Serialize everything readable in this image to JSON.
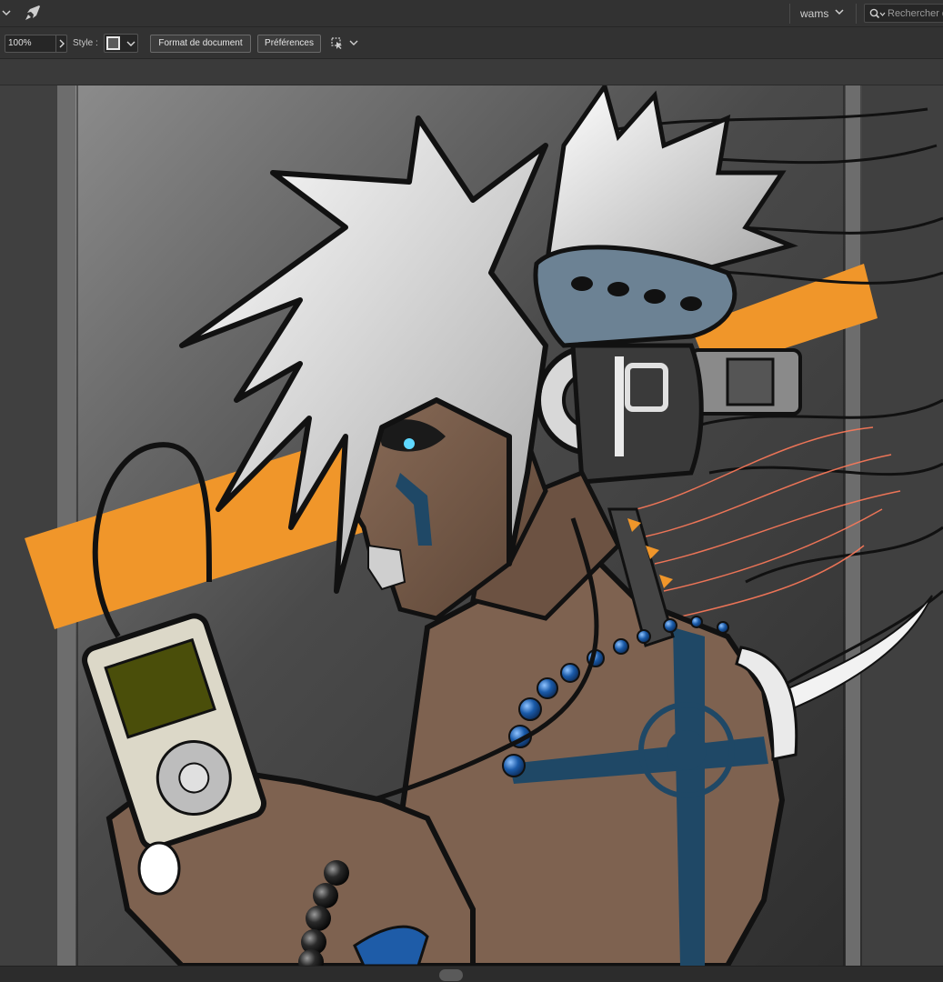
{
  "topbar": {
    "workspace_label": "wams",
    "search_placeholder": "Rechercher d"
  },
  "control_bar": {
    "zoom_value": "100%",
    "style_label": "Style :",
    "document_setup_button": "Format de document",
    "preferences_button": "Préférences"
  },
  "colors": {
    "panel_bg": "#323232",
    "canvas_bg": "#444444",
    "accent_orange": "#f0962a",
    "tattoo_blue": "#1f4866",
    "skin": "#7e6250"
  },
  "icons": {
    "menu_chevron": "chevron-down-icon",
    "share": "share-rocket-icon",
    "search": "search-icon",
    "arrange": "arrange-selection-icon"
  }
}
